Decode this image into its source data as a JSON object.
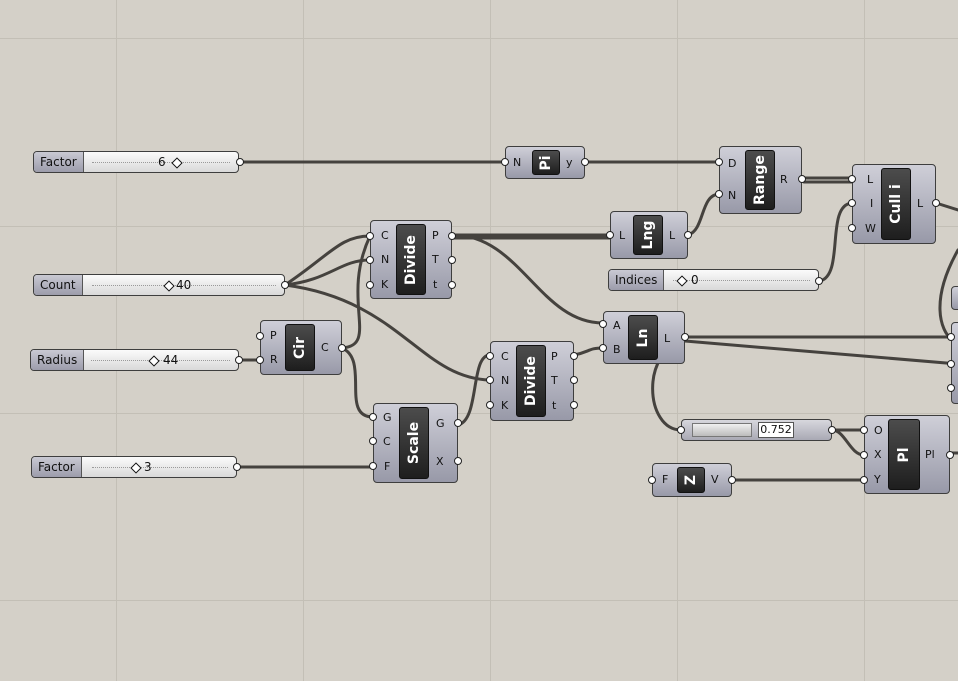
{
  "sliders": {
    "factor1": {
      "label": "Factor",
      "value": "6"
    },
    "count": {
      "label": "Count",
      "value": "40"
    },
    "radius": {
      "label": "Radius",
      "value": "44"
    },
    "factor2": {
      "label": "Factor",
      "value": "3"
    },
    "indices": {
      "label": "Indices",
      "value": "0"
    }
  },
  "components": {
    "pi": {
      "nickname": "Pi",
      "inputs": [
        "N"
      ],
      "outputs": [
        "y"
      ]
    },
    "range": {
      "nickname": "Range",
      "inputs": [
        "D",
        "N"
      ],
      "outputs": [
        "R"
      ]
    },
    "cull": {
      "nickname": "Cull i",
      "inputs": [
        "L",
        "I",
        "W"
      ],
      "outputs": [
        "L"
      ]
    },
    "lng": {
      "nickname": "Lng",
      "inputs": [
        "L"
      ],
      "outputs": [
        "L"
      ]
    },
    "divide1": {
      "nickname": "Divide",
      "inputs": [
        "C",
        "N",
        "K"
      ],
      "outputs": [
        "P",
        "T",
        "t"
      ]
    },
    "cir": {
      "nickname": "Cir",
      "inputs": [
        "P",
        "R"
      ],
      "outputs": [
        "C"
      ]
    },
    "divide2": {
      "nickname": "Divide",
      "inputs": [
        "C",
        "N",
        "K"
      ],
      "outputs": [
        "P",
        "T",
        "t"
      ]
    },
    "ln": {
      "nickname": "Ln",
      "inputs": [
        "A",
        "B"
      ],
      "outputs": [
        "L"
      ]
    },
    "scale": {
      "nickname": "Scale",
      "inputs": [
        "G",
        "C",
        "F"
      ],
      "outputs": [
        "G",
        "X"
      ]
    },
    "pl": {
      "nickname": "Pl",
      "inputs": [
        "O",
        "X",
        "Y"
      ],
      "outputs": [
        "Pl"
      ]
    },
    "z": {
      "nickname": "Z",
      "inputs": [
        "F"
      ],
      "outputs": [
        "V"
      ]
    }
  },
  "panel": {
    "value": "0.752"
  }
}
